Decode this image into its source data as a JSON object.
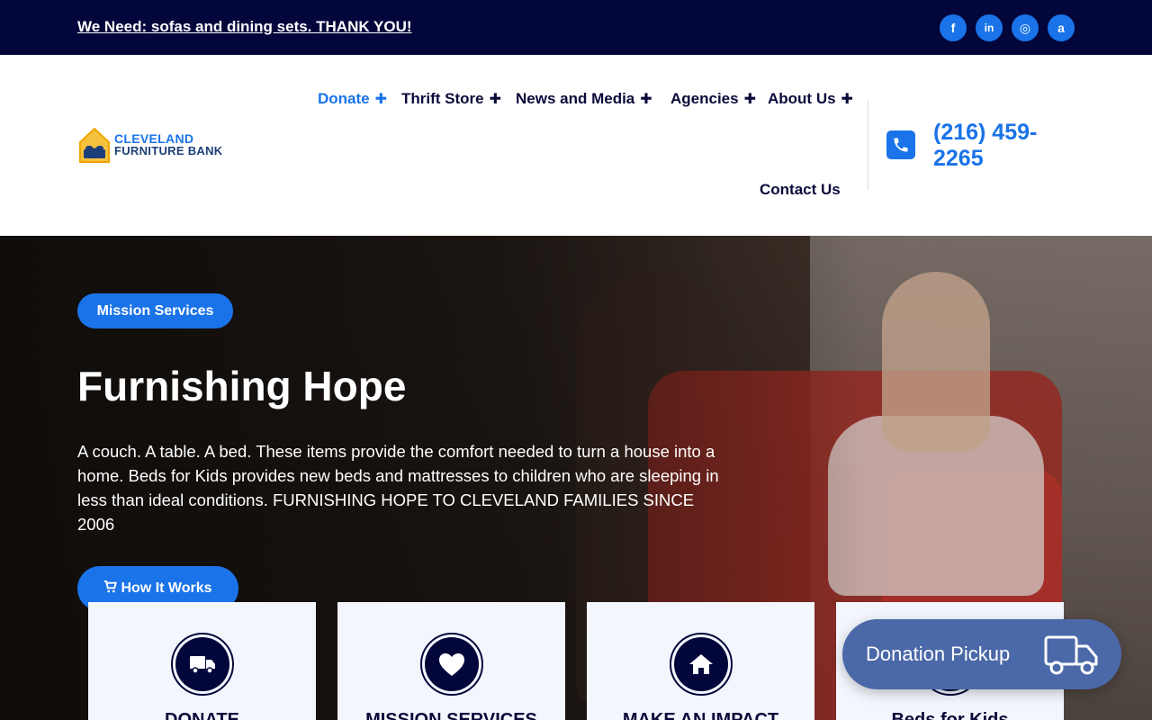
{
  "topbar": {
    "announcement": "We Need: sofas and dining sets. THANK YOU!",
    "social": [
      {
        "icon": "facebook-icon",
        "glyph": "f"
      },
      {
        "icon": "linkedin-icon",
        "glyph": "in"
      },
      {
        "icon": "instagram-icon",
        "glyph": "◎"
      },
      {
        "icon": "amazon-icon",
        "glyph": "a"
      }
    ]
  },
  "logo": {
    "line1": "CLEVELAND",
    "line2": "FURNITURE BANK"
  },
  "nav": {
    "items": [
      {
        "label": "Donate",
        "active": true
      },
      {
        "label": "Thrift Store",
        "active": false
      },
      {
        "label": "News and Media",
        "active": false
      },
      {
        "label": "Agencies",
        "active": false
      },
      {
        "label": "About Us",
        "active": false
      }
    ],
    "contact": "Contact Us",
    "plus_glyph": "✚",
    "phone": "(216) 459-2265"
  },
  "hero": {
    "tag": "Mission Services",
    "title": "Furnishing Hope",
    "text": "A couch. A table. A bed. These items provide the comfort needed to turn a house into a home. Beds for Kids provides new beds and mattresses to children who are sleeping in less than ideal conditions. FURNISHING HOPE TO CLEVELAND FAMILIES SINCE 2006",
    "button": "How It Works",
    "button_icon": "cart-icon"
  },
  "cards": [
    {
      "title": "DONATE",
      "icon": "truck-icon"
    },
    {
      "title": "MISSION SERVICES",
      "icon": "heart-icon"
    },
    {
      "title": "MAKE AN IMPACT",
      "icon": "home-icon"
    },
    {
      "title": "Beds for Kids",
      "icon": "bed-icon"
    }
  ],
  "pickup": {
    "label": "Donation Pickup",
    "icon": "truck-icon"
  },
  "colors": {
    "navy": "#03063b",
    "accent_blue": "#1a73e8",
    "pickup_blue": "#4b68a8",
    "card_bg": "#f3f7fd"
  }
}
